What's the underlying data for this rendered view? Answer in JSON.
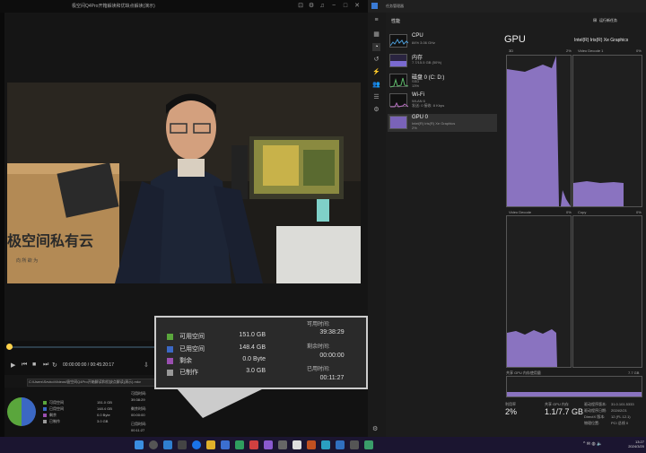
{
  "player": {
    "title": "极空间Q4Pro开箱解读和优缺点解读(演示)",
    "timecode": "00:00:00:00 / 00:45:20:17",
    "path": "C:\\Users\\Sevko\\Videos\\极空间Q4Pro开箱解读和优缺点解读(演示).mkv",
    "box_text": "极空间私有云",
    "box_subtext": "向    所    欲    为"
  },
  "storage_overlay": {
    "rows": [
      {
        "label": "可用空间",
        "value": "151.0  GB",
        "color": "#5aa63c"
      },
      {
        "label": "已用空间",
        "value": "148.4  GB",
        "color": "#3b68c4"
      },
      {
        "label": "剩余",
        "value": "0.0  Byte",
        "color": "#9a4fb0"
      },
      {
        "label": "已制作",
        "value": "3.0  GB",
        "color": "#999999"
      }
    ],
    "avail_time_label": "可用时间:",
    "avail_time": "39:38:29",
    "remain_time_label": "剩余时间:",
    "remain_time": "00:00:00",
    "used_time_label": "已用时间:",
    "used_time": "00:11:27"
  },
  "mini_stats": {
    "rows": [
      {
        "label": "可用空间",
        "value": "151.0  GB",
        "color": "#5aa63c"
      },
      {
        "label": "已用空间",
        "value": "148.4  GB",
        "color": "#3b68c4"
      },
      {
        "label": "剩余",
        "value": "0.0  Byte",
        "color": "#9a4fb0"
      },
      {
        "label": "已制作",
        "value": "3.0  GB",
        "color": "#999999"
      }
    ],
    "t1_label": "可用时间:",
    "t1": "39:38:29",
    "t2_label": "剩余时间:",
    "t2": "00:00:00",
    "t3_label": "已用时间:",
    "t3": "00:11:27"
  },
  "taskmgr": {
    "window_title": "任务管理器",
    "section_title": "性能",
    "run_task": "运行新任务",
    "resources": [
      {
        "name": "CPU",
        "sub": "84%  3.06 GHz",
        "color": "#4b9bd6"
      },
      {
        "name": "内存",
        "sub": "7.7/15.5 GB (50%)",
        "color": "#7a6ad0"
      },
      {
        "name": "磁盘 0 (C: D:)",
        "sub": "SSD",
        "sub2": "13%",
        "color": "#5db86a"
      },
      {
        "name": "Wi-Fi",
        "sub": "WLAN 6",
        "sub2": "发送: 0  接收: 8 Kbps",
        "color": "#b76fc1"
      },
      {
        "name": "GPU 0",
        "sub": "Intel(R) Iris(R) Xe Graphics",
        "sub2": "2%",
        "color": "#9b7fd4"
      }
    ],
    "gpu_title": "GPU",
    "gpu_name": "Intel(R) Iris(R) Xe Graphics",
    "engine_3d": "3D",
    "engine_3d_pct": "2%",
    "engine_vd1": "Video Decode 1",
    "engine_vd1_pct": "0%",
    "engine_vd": "Video Decode",
    "engine_vd_pct": "0%",
    "engine_copy": "Copy",
    "engine_copy_pct": "0%",
    "shared_mem_label": "共享 GPU 内存使用量",
    "shared_mem_max": "7.7 GB",
    "util_label": "利用率",
    "util": "2%",
    "shared_label": "共享 GPU 内存",
    "shared": "1.1/7.7 GB",
    "driver_label": "驱动程序版本:",
    "driver": "31.0.101.5333",
    "date_label": "驱动程序日期:",
    "date": "2024/2/21",
    "dx_label": "DirectX 版本:",
    "dx": "12 (FL 12.1)",
    "loc_label": "物理位置:",
    "loc": "PCI 总线 0"
  },
  "taskbar": {
    "time": "13:27",
    "date": "2024/3/20",
    "tray": "^  ✉  ◍  🔈"
  }
}
